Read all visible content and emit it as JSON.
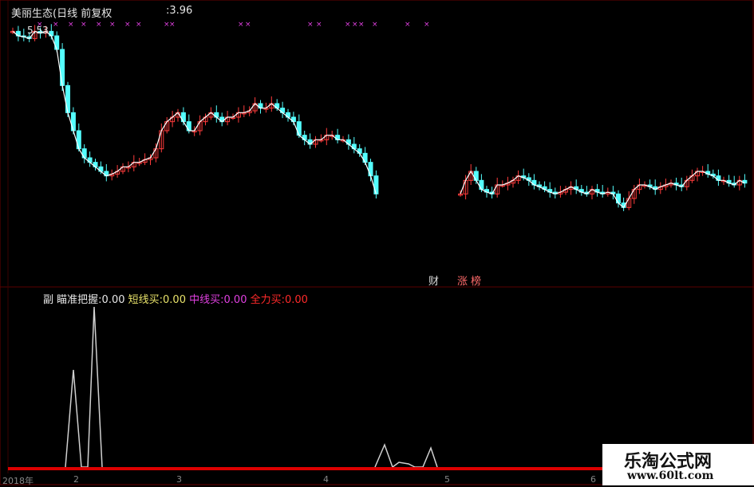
{
  "header": {
    "title": "美丽生态(日线 前复权",
    "price": ":3.96",
    "high_label": "5.53"
  },
  "events": {
    "cai": "财",
    "zhang": "涨",
    "bang": "榜"
  },
  "indicator": {
    "prefix": "副",
    "items": [
      {
        "label": "瞄准把握:",
        "value": "0.00",
        "color": "#e8e8e8"
      },
      {
        "label": "短线买:",
        "value": "0.00",
        "color": "#e8e26a"
      },
      {
        "label": "中线买:",
        "value": "0.00",
        "color": "#e040e0"
      },
      {
        "label": "全力买:",
        "value": "0.00",
        "color": "#ff2a2a"
      }
    ]
  },
  "dates": {
    "year": "2018年",
    "m2": "2",
    "m3": "3",
    "m4": "4",
    "m5": "5",
    "m6": "6"
  },
  "watermark": {
    "cn": "乐淘公式网",
    "url": "www.60lt.com"
  },
  "colors": {
    "up": "#ff3b3b",
    "down": "#54ffff",
    "bg": "#000000",
    "line": "#ffffff",
    "marker": "#e040e0",
    "baseline": "#dd0000"
  },
  "chart_data": {
    "type": "candlestick",
    "price_range": [
      3.2,
      5.6
    ],
    "close_segment1": [
      5.5,
      5.45,
      5.44,
      5.42,
      5.5,
      5.48,
      5.5,
      5.45,
      5.3,
      4.9,
      4.6,
      4.4,
      4.2,
      4.1,
      4.05,
      4.0,
      3.95,
      3.9,
      3.92,
      3.95,
      4.0,
      4.0,
      4.05,
      4.05,
      4.08,
      4.1,
      4.2,
      4.4,
      4.5,
      4.55,
      4.6,
      4.5,
      4.4,
      4.4,
      4.5,
      4.55,
      4.6,
      4.55,
      4.5,
      4.55,
      4.55,
      4.6,
      4.6,
      4.62,
      4.7,
      4.65,
      4.65,
      4.7,
      4.65,
      4.6,
      4.55,
      4.5,
      4.35,
      4.3,
      4.25,
      4.3,
      4.3,
      4.35,
      4.35,
      4.3,
      4.3,
      4.25,
      4.2,
      4.15,
      4.05,
      3.9,
      3.7
    ],
    "close_segment2": [
      3.7,
      3.85,
      3.95,
      3.85,
      3.75,
      3.72,
      3.7,
      3.8,
      3.8,
      3.82,
      3.85,
      3.9,
      3.88,
      3.85,
      3.8,
      3.78,
      3.75,
      3.72,
      3.7,
      3.72,
      3.75,
      3.78,
      3.75,
      3.72,
      3.7,
      3.75,
      3.72,
      3.7,
      3.72,
      3.7,
      3.6,
      3.55,
      3.65,
      3.75,
      3.8,
      3.8,
      3.78,
      3.75,
      3.78,
      3.8,
      3.82,
      3.8,
      3.78,
      3.85,
      3.9,
      3.95,
      3.95,
      3.92,
      3.9,
      3.85,
      3.85,
      3.82,
      3.8,
      3.85,
      3.82
    ]
  }
}
